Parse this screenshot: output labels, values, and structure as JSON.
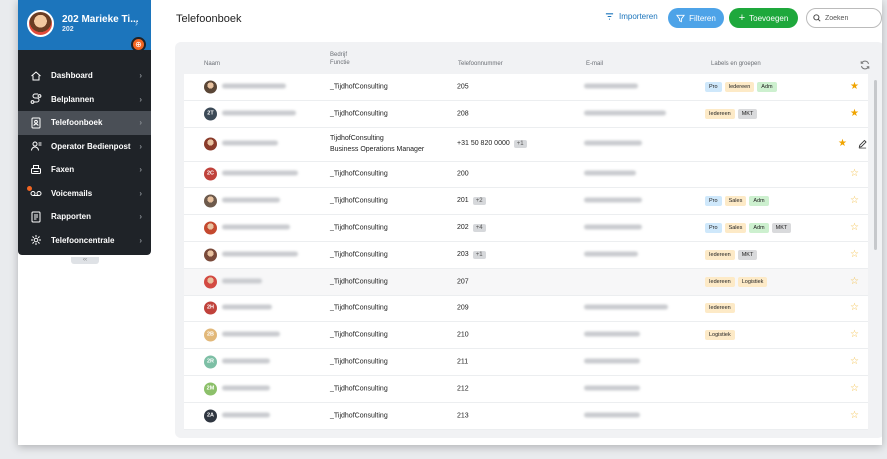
{
  "sidebar": {
    "profile_name": "202 Marieke Ti...",
    "profile_ext": "202",
    "items": [
      {
        "label": "Dashboard",
        "icon": "home-icon",
        "active": false
      },
      {
        "label": "Belplannen",
        "icon": "route-icon",
        "active": false
      },
      {
        "label": "Telefoonboek",
        "icon": "address-book-icon",
        "active": true
      },
      {
        "label": "Operator Bedienpost",
        "icon": "operator-icon",
        "active": false
      },
      {
        "label": "Faxen",
        "icon": "fax-icon",
        "active": false
      },
      {
        "label": "Voicemails",
        "icon": "voicemail-icon",
        "active": false
      },
      {
        "label": "Rapporten",
        "icon": "report-icon",
        "active": false
      },
      {
        "label": "Telefooncentrale",
        "icon": "gear-icon",
        "active": false
      }
    ],
    "collapse_label": "‹‹"
  },
  "header": {
    "title": "Telefoonboek",
    "import_label": "Importeren",
    "filter_label": "Filteren",
    "add_label": "Toevoegen",
    "search_placeholder": "Zoeken"
  },
  "table": {
    "columns": {
      "name": "Naam",
      "company": "Bedrijf",
      "function": "Functie",
      "phone": "Telefoonnummer",
      "email": "E-mail",
      "labels": "Labels en groepen"
    },
    "rows": [
      {
        "avatar": "photo",
        "avatar_color": "#5a4636",
        "initials": "",
        "name_w": 64,
        "company": "_TijdhofConsulting",
        "function": "",
        "phone": "205",
        "extra": "",
        "email_w": 54,
        "tags": [
          "Pro",
          "Iedereen",
          "Adm"
        ],
        "starred": true
      },
      {
        "avatar": "initials",
        "avatar_color": "#3c4a57",
        "initials": "2T",
        "name_w": 74,
        "company": "_TijdhofConsulting",
        "function": "",
        "phone": "208",
        "extra": "",
        "email_w": 82,
        "tags": [
          "Iedereen",
          "MKT"
        ],
        "starred": true
      },
      {
        "avatar": "photo",
        "avatar_color": "#8a3b2a",
        "initials": "",
        "name_w": 56,
        "company": "TijdhofConsulting",
        "function": "Business Operations Manager",
        "phone": "+31 50 820 0000",
        "extra": "+1",
        "email_w": 58,
        "tags": [],
        "starred": true,
        "tall": true,
        "edit": true
      },
      {
        "avatar": "initials",
        "avatar_color": "#c0423b",
        "initials": "2C",
        "name_w": 76,
        "company": "_TijdhofConsulting",
        "function": "",
        "phone": "200",
        "extra": "",
        "email_w": 52,
        "tags": [],
        "starred": false
      },
      {
        "avatar": "photo",
        "avatar_color": "#6d5a4c",
        "initials": "",
        "name_w": 58,
        "company": "_TijdhofConsulting",
        "function": "",
        "phone": "201",
        "extra": "+2",
        "email_w": 58,
        "tags": [
          "Pro",
          "Sales",
          "Adm"
        ],
        "starred": false
      },
      {
        "avatar": "photo",
        "avatar_color": "#c4492f",
        "initials": "",
        "name_w": 68,
        "company": "_TijdhofConsulting",
        "function": "",
        "phone": "202",
        "extra": "+4",
        "email_w": 58,
        "tags": [
          "Pro",
          "Sales",
          "Adm",
          "MKT"
        ],
        "starred": false
      },
      {
        "avatar": "photo",
        "avatar_color": "#7a4a3a",
        "initials": "",
        "name_w": 76,
        "company": "_TijdhofConsulting",
        "function": "",
        "phone": "203",
        "extra": "+1",
        "email_w": 54,
        "tags": [
          "Iedereen",
          "MKT"
        ],
        "starred": false
      },
      {
        "avatar": "photo",
        "avatar_color": "#d34a42",
        "initials": "",
        "name_w": 40,
        "company": "_TijdhofConsulting",
        "function": "",
        "phone": "207",
        "extra": "",
        "email_w": 0,
        "tags": [
          "Iedereen",
          "Logistiek"
        ],
        "starred": false,
        "hover": true
      },
      {
        "avatar": "initials",
        "avatar_color": "#c0423b",
        "initials": "2H",
        "name_w": 50,
        "company": "_TijdhofConsulting",
        "function": "",
        "phone": "209",
        "extra": "",
        "email_w": 84,
        "tags": [
          "Iedereen"
        ],
        "starred": false
      },
      {
        "avatar": "initials",
        "avatar_color": "#e2b879",
        "initials": "2B",
        "name_w": 58,
        "company": "_TijdhofConsulting",
        "function": "",
        "phone": "210",
        "extra": "",
        "email_w": 56,
        "tags": [
          "Logistiek"
        ],
        "starred": false
      },
      {
        "avatar": "initials",
        "avatar_color": "#7dbfa5",
        "initials": "2R",
        "name_w": 48,
        "company": "_TijdhofConsulting",
        "function": "",
        "phone": "211",
        "extra": "",
        "email_w": 56,
        "tags": [],
        "starred": false
      },
      {
        "avatar": "initials",
        "avatar_color": "#8cc06a",
        "initials": "2M",
        "name_w": 48,
        "company": "_TijdhofConsulting",
        "function": "",
        "phone": "212",
        "extra": "",
        "email_w": 56,
        "tags": [],
        "starred": false
      },
      {
        "avatar": "initials",
        "avatar_color": "#2f3640",
        "initials": "2A",
        "name_w": 48,
        "company": "_TijdhofConsulting",
        "function": "",
        "phone": "213",
        "extra": "",
        "email_w": 56,
        "tags": [],
        "starred": false
      }
    ]
  },
  "colors": {
    "sidebar_bg": "#1f2328",
    "profile_bg": "#1c75bc",
    "accent_blue": "#4da3e8",
    "add_green": "#1ea83c",
    "star": "#f0a400",
    "status_orange": "#f26522"
  }
}
